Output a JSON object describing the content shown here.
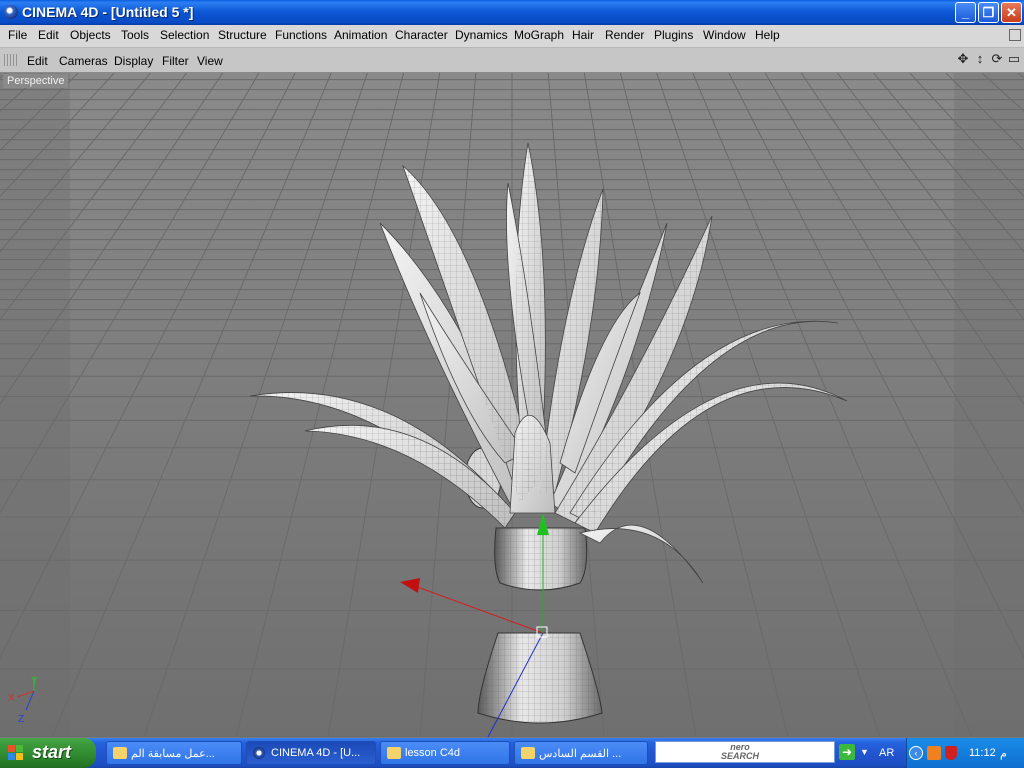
{
  "window": {
    "title": "CINEMA 4D - [Untitled 5 *]"
  },
  "menu": [
    "File",
    "Edit",
    "Objects",
    "Tools",
    "Selection",
    "Structure",
    "Functions",
    "Animation",
    "Character",
    "Dynamics",
    "MoGraph",
    "Hair",
    "Render",
    "Plugins",
    "Window",
    "Help"
  ],
  "viewmenu": [
    "Edit",
    "Cameras",
    "Display",
    "Filter",
    "View"
  ],
  "viewport": {
    "label": "Perspective",
    "axes": {
      "x": "X",
      "y": "Y",
      "z": "Z"
    }
  },
  "taskbar": {
    "start": "start",
    "tasks": [
      "عمل مسابقة الم...",
      "CINEMA 4D - [U...",
      "lesson C4d",
      "القسم السادس ..."
    ],
    "search_logo": [
      "nero",
      "SEARCH"
    ],
    "lang": "AR",
    "ampm": "م",
    "time": "11:12"
  }
}
